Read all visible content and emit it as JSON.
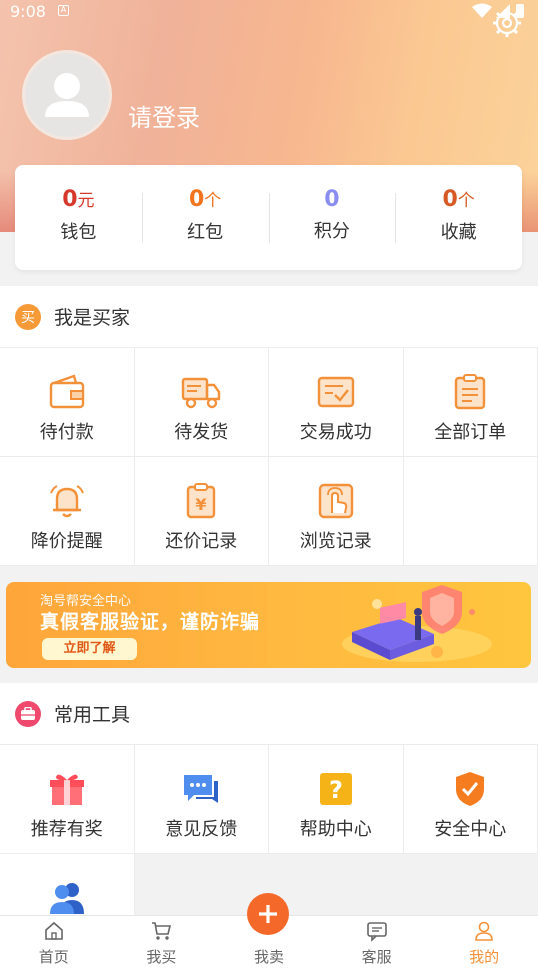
{
  "status_bar": {
    "time": "9:08",
    "a_badge": "A"
  },
  "profile": {
    "login_text": "请登录"
  },
  "stats": [
    {
      "value": "0",
      "unit": "元",
      "label": "钱包",
      "color": "#d6392b"
    },
    {
      "value": "0",
      "unit": "个",
      "label": "红包",
      "color": "#f2741f"
    },
    {
      "value": "0",
      "unit": "",
      "label": "积分",
      "color": "#8b8ef1"
    },
    {
      "value": "0",
      "unit": "个",
      "label": "收藏",
      "color": "#d65a24"
    }
  ],
  "buyer": {
    "badge": "买",
    "title": "我是买家",
    "items": [
      {
        "label": "待付款",
        "icon": "wallet-icon"
      },
      {
        "label": "待发货",
        "icon": "truck-icon"
      },
      {
        "label": "交易成功",
        "icon": "checked-box-icon"
      },
      {
        "label": "全部订单",
        "icon": "clipboard-icon"
      },
      {
        "label": "降价提醒",
        "icon": "bell-icon"
      },
      {
        "label": "还价记录",
        "icon": "yen-clipboard-icon"
      },
      {
        "label": "浏览记录",
        "icon": "touch-icon"
      }
    ]
  },
  "banner": {
    "subtitle": "淘号帮安全中心",
    "title": "真假客服验证，谨防诈骗",
    "button": "立即了解"
  },
  "tools": {
    "title": "常用工具",
    "items": [
      {
        "label": "推荐有奖",
        "icon": "gift-icon"
      },
      {
        "label": "意见反馈",
        "icon": "chat-bubble-icon"
      },
      {
        "label": "帮助中心",
        "icon": "question-icon"
      },
      {
        "label": "安全中心",
        "icon": "shield-check-icon"
      },
      {
        "label": "",
        "icon": "users-icon"
      }
    ]
  },
  "tabbar": {
    "items": [
      {
        "label": "首页",
        "icon": "home-icon"
      },
      {
        "label": "我买",
        "icon": "cart-icon"
      },
      {
        "label": "我卖",
        "icon": "plus-icon"
      },
      {
        "label": "客服",
        "icon": "message-icon"
      },
      {
        "label": "我的",
        "icon": "person-icon"
      }
    ],
    "active": "我的",
    "active_color": "#f3913a"
  },
  "colors": {
    "orange": "#f4692a",
    "accent": "#f3913a"
  }
}
